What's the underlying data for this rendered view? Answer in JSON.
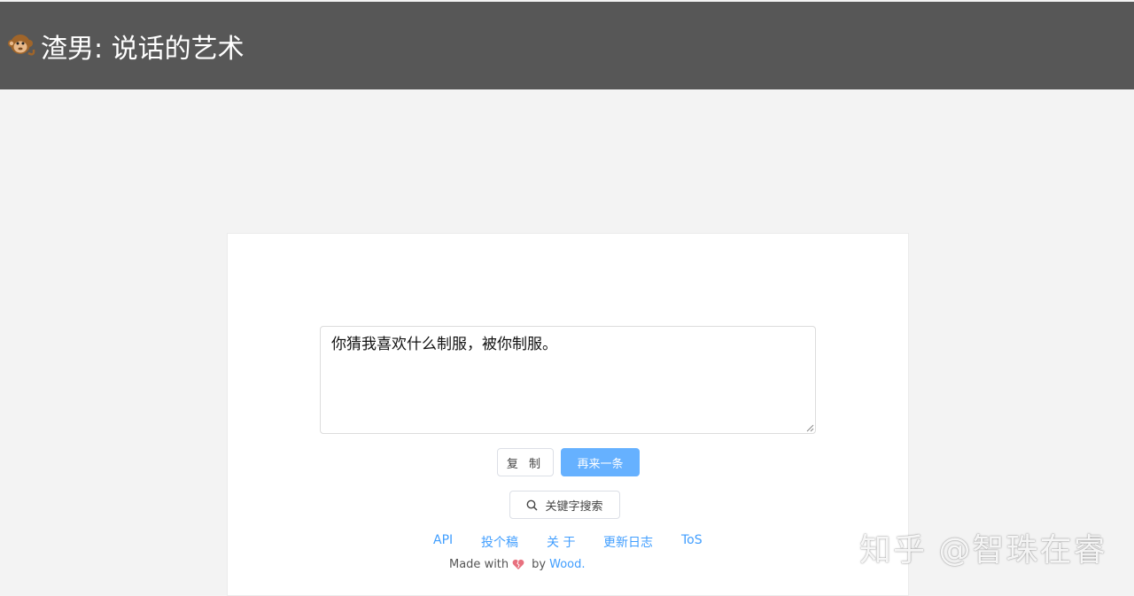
{
  "header": {
    "logo_icon": "monkey-icon",
    "title": "渣男: 说话的艺术",
    "background": "#575757"
  },
  "main": {
    "quote": "你猜我喜欢什么制服，被你制服。",
    "copy_button": "复 制",
    "next_button": "再来一条",
    "search_button": "关键字搜索",
    "accent_color": "#66b1ff"
  },
  "footer": {
    "links": [
      "API",
      "投个稿",
      "关 于",
      "更新日志",
      "ToS"
    ],
    "made_with": "Made with",
    "by": "by",
    "author": "Wood."
  },
  "watermark": "知乎 @智珠在睿"
}
